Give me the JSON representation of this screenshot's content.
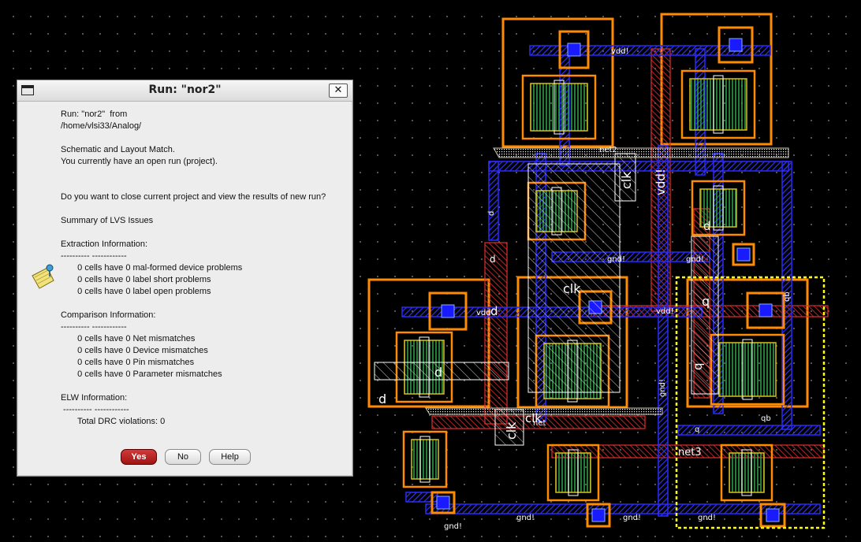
{
  "dialog": {
    "title": "Run: \"nor2\"",
    "close_label": "✕",
    "lines": [
      "Run: \"nor2\"  from",
      "/home/vlsi33/Analog/",
      "",
      "Schematic and Layout Match.",
      "You currently have an open run (project).",
      "",
      "",
      "Do you want to close current project and view the results of new run?",
      "",
      "Summary of LVS Issues",
      "",
      "Extraction Information:",
      "---------- ------------",
      "   0 cells have 0 mal-formed device problems",
      "   0 cells have 0 label short problems",
      "   0 cells have 0 label open problems",
      "",
      "Comparison Information:",
      "---------- ------------",
      "   0 cells have 0 Net mismatches",
      "   0 cells have 0 Device mismatches",
      "   0 cells have 0 Pin mismatches",
      "   0 cells have 0 Parameter mismatches",
      "",
      "ELW Information:",
      " ---------- ------------",
      "   Total DRC violations: 0"
    ],
    "buttons": {
      "yes": "Yes",
      "no": "No",
      "help": "Help"
    }
  },
  "layout_labels": {
    "vdd_top": "vdd!",
    "net2": "net2",
    "clk_top": "clk",
    "vdd_vertical": "vdd!",
    "d_left": "d",
    "d_pin": "d",
    "gnd_mid_left": "gnd!",
    "gnd_mid_right": "gnd!",
    "d_right": "d",
    "clk_mid": "clk",
    "vdd_mid": "vdd!",
    "vdd_left": "vdd",
    "d_mid": "d",
    "q_mid": "q",
    "qb_right": "qb",
    "d_lower": "d",
    "d_lower2": "d",
    "clk_low1": "clk",
    "clk_low2": "clk",
    "net_low": "net",
    "gnd_vertical": "gnd!",
    "q_low": "q",
    "q_low2": "q",
    "qb_low": "qb",
    "net3": "net3",
    "gnd_bottom1": "gnd!",
    "gnd_bottom2": "gnd!",
    "gnd_bottom3": "gnd!",
    "gnd_bottom4": "gnd!"
  },
  "colors": {
    "background": "#000000",
    "nwell": "#ff8c00",
    "metal1": "#2b2bff",
    "poly": "#e03030",
    "active": "#2fa84a",
    "implant": "#d8c018",
    "selection": "#ffff00",
    "yes_button": "#b01818"
  },
  "icons": {
    "dialog_icon": "note-icon",
    "window_icon": "window-icon",
    "close": "close-icon"
  }
}
